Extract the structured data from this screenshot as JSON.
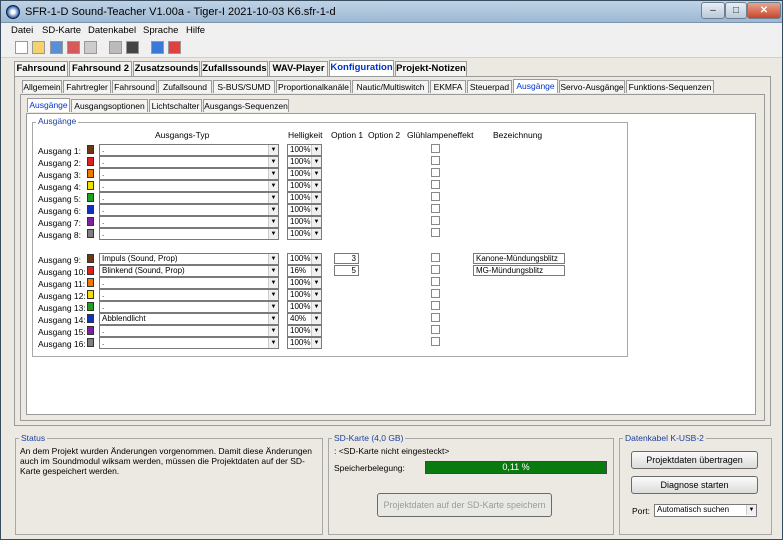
{
  "window": {
    "title": "SFR-1-D Sound-Teacher V1.00a - Tiger-I 2021-10-03 K6.sfr-1-d",
    "min": "–",
    "max": "□",
    "close": "✕"
  },
  "menu": [
    "Datei",
    "SD-Karte",
    "Datenkabel",
    "Sprache",
    "Hilfe"
  ],
  "toolbar_icons": [
    "new-icon",
    "open-icon",
    "save-icon",
    "save-as-icon",
    "print-icon",
    "grid-icon",
    "transfer-icon",
    "music-icon",
    "pdf-icon"
  ],
  "tabs_main": [
    "Fahrsound",
    "Fahrsound 2",
    "Zusatzsounds",
    "Zufallssounds",
    "WAV-Player",
    "Konfiguration",
    "Projekt-Notizen"
  ],
  "tabs_config": [
    "Allgemein",
    "Fahrtregler",
    "Fahrsound",
    "Zufallsound",
    "S-BUS/SUMD",
    "Proportionalkanäle",
    "Nautic/Multiswitch",
    "EKMFA",
    "Steuerpad",
    "Ausgänge",
    "Servo-Ausgänge",
    "Funktions-Sequenzen"
  ],
  "tabs_outputs": [
    "Ausgänge",
    "Ausgangsoptionen",
    "Lichtschalter",
    "Ausgangs-Sequenzen"
  ],
  "group_title": "Ausgänge",
  "headers": {
    "type": "Ausgangs-Typ",
    "brightness": "Helligkeit",
    "opt1": "Option 1",
    "opt2": "Option 2",
    "glow": "Glühlampeneffekt",
    "name": "Bezeichnung"
  },
  "outputs": [
    {
      "label": "Ausgang 1:",
      "color": "#6b3a10",
      "type": ".",
      "bright": "100%"
    },
    {
      "label": "Ausgang 2:",
      "color": "#e02020",
      "type": ".",
      "bright": "100%"
    },
    {
      "label": "Ausgang 3:",
      "color": "#f07800",
      "type": ".",
      "bright": "100%"
    },
    {
      "label": "Ausgang 4:",
      "color": "#f0e000",
      "type": ".",
      "bright": "100%"
    },
    {
      "label": "Ausgang 5:",
      "color": "#20a020",
      "type": ".",
      "bright": "100%"
    },
    {
      "label": "Ausgang 6:",
      "color": "#1030c0",
      "type": ".",
      "bright": "100%"
    },
    {
      "label": "Ausgang 7:",
      "color": "#8020a0",
      "type": ".",
      "bright": "100%"
    },
    {
      "label": "Ausgang 8:",
      "color": "#808080",
      "type": ".",
      "bright": "100%"
    },
    {
      "label": "Ausgang 9:",
      "color": "#6b3a10",
      "type": "Impuls (Sound, Prop)",
      "bright": "100%",
      "opt1": "3",
      "name": "Kanone-Mündungsblitz"
    },
    {
      "label": "Ausgang 10:",
      "color": "#e02020",
      "type": "Blinkend (Sound, Prop)",
      "bright": "16%",
      "opt1": "5",
      "name": "MG-Mündungsblitz"
    },
    {
      "label": "Ausgang 11:",
      "color": "#f07800",
      "type": ".",
      "bright": "100%"
    },
    {
      "label": "Ausgang 12:",
      "color": "#f0e000",
      "type": ".",
      "bright": "100%"
    },
    {
      "label": "Ausgang 13:",
      "color": "#20a020",
      "type": ".",
      "bright": "100%"
    },
    {
      "label": "Ausgang 14:",
      "color": "#1030c0",
      "type": "Abblendlicht",
      "bright": "40%"
    },
    {
      "label": "Ausgang 15:",
      "color": "#8020a0",
      "type": ".",
      "bright": "100%"
    },
    {
      "label": "Ausgang 16:",
      "color": "#808080",
      "type": ".",
      "bright": "100%"
    }
  ],
  "status": {
    "title": "Status",
    "text": "An dem Projekt wurden Änderungen vorgenommen. Damit diese Änderungen auch im Soundmodul wiksam werden, müssen die Projektdaten auf der SD-Karte gespeichert werden."
  },
  "sd": {
    "title": "SD-Karte (4,0 GB)",
    "state": ": <SD-Karte nicht eingesteckt>",
    "usage_label": "Speicherbelegung:",
    "usage": "0,11 %",
    "save_btn": "Projektdaten auf der SD-Karte speichern"
  },
  "cable": {
    "title": "Datenkabel K-USB-2",
    "transfer_btn": "Projektdaten übertragen",
    "diag_btn": "Diagnose starten",
    "port_label": "Port:",
    "port_value": "Automatisch suchen"
  }
}
